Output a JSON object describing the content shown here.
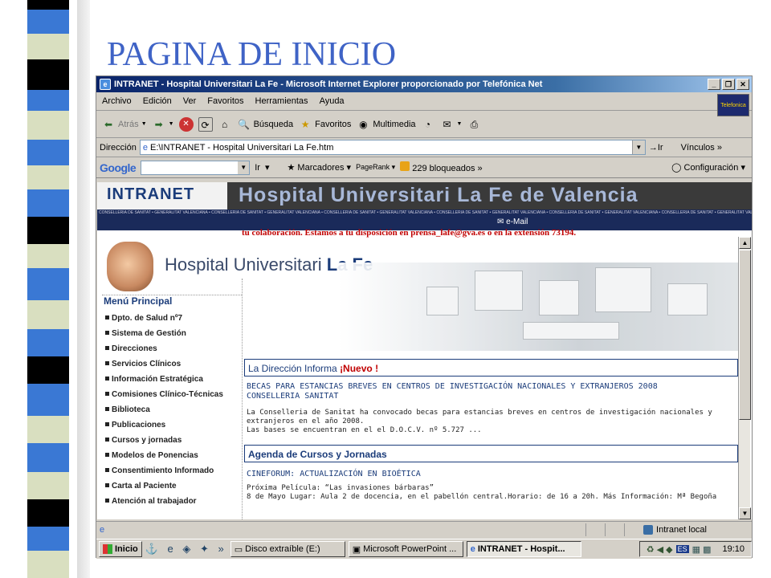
{
  "slide_title": "PAGINA DE INICIO",
  "window": {
    "title": "INTRANET - Hospital Universitari La Fe - Microsoft Internet Explorer proporcionado por Telefónica Net",
    "min": "_",
    "max": "❐",
    "close": "✕"
  },
  "menu": [
    "Archivo",
    "Edición",
    "Ver",
    "Favoritos",
    "Herramientas",
    "Ayuda"
  ],
  "isp_logo": "Telefonica",
  "toolbar": {
    "back": "Atrás",
    "search": "Búsqueda",
    "favorites": "Favoritos",
    "multimedia": "Multimedia"
  },
  "address": {
    "label": "Dirección",
    "value": "E:\\INTRANET - Hospital Universitari La Fe.htm",
    "go": "Ir",
    "links": "Vínculos"
  },
  "google": {
    "logo": "Google",
    "go": "Ir",
    "bookmarks": "Marcadores",
    "pagerank": "PageRank",
    "blocked": "229 bloqueados",
    "config": "Configuración"
  },
  "page": {
    "intranet": "INTRANET",
    "hospital_banner": "Hospital Universitari La Fe de Valencia",
    "consell_line": "CONSELLERIA DE SANITAT • GENERALITAT VALENCIANA • CONSELLERIA DE SANITAT • GENERALITAT VALENCIANA • CONSELLERIA DE SANITAT • GENERALITAT VALENCIANA • CONSELLERIA DE SANITAT • GENERALITAT VALENCIANA • CONSELLERIA DE SANITAT • GENERALITAT VALENCIANA • CONSELLERIA DE SANITAT • GENERALITAT VALENCIANA",
    "email": "✉ e-Mail",
    "scroll_message": "tu colaboración. Estamos a tu disposición en prensa_lafe@gva.es o en la extensión 73194.",
    "logo_text_1": "Hospital Universitari",
    "logo_text_2": "La Fe",
    "menu_title": "Menú Principal",
    "menu_items": [
      "Dpto. de Salud nº7",
      "Sistema de Gestión",
      "Direcciones",
      "Servicios Clínicos",
      "Información Estratégica",
      "Comisiones Clínico-Técnicas",
      "Biblioteca",
      "Publicaciones",
      "Cursos y jornadas",
      "Modelos de Ponencias",
      "Consentimiento Informado",
      "Carta al Paciente",
      "Atención al trabajador"
    ],
    "direccion_title": "La Dirección Informa",
    "nuevo": "¡Nuevo !",
    "news_head_1": "BECAS PARA ESTANCIAS BREVES EN CENTROS DE INVESTIGACIÓN NACIONALES Y EXTRANJEROS 2008",
    "news_head_2": "CONSELLERIA SANITAT",
    "news_body_1": "La Conselleria de Sanitat ha convocado becas para estancias breves en centros de investigación nacionales y",
    "news_body_2": "extranjeros en el año 2008.",
    "news_body_3": "Las bases se encuentran en el el D.O.C.V. nº 5.727 ...",
    "agenda_title": "Agenda de Cursos y Jornadas",
    "cine_head": "CINEFORUM: ACTUALIZACIÓN EN BIOÉTICA",
    "cine_body_1": "Próxima Película: “Las invasiones bárbaras”",
    "cine_body_2": "8 de Mayo Lugar: Aula 2 de docencia, en el pabellón central.Horario: de 16 a 20h. Más Información: Mª Begoña"
  },
  "status": {
    "zone": "Intranet local"
  },
  "taskbar": {
    "start": "Inicio",
    "tasks": [
      "Disco extraíble (E:)",
      "Microsoft PowerPoint ...",
      "INTRANET - Hospit..."
    ],
    "lang": "ES",
    "time": "19:10"
  }
}
